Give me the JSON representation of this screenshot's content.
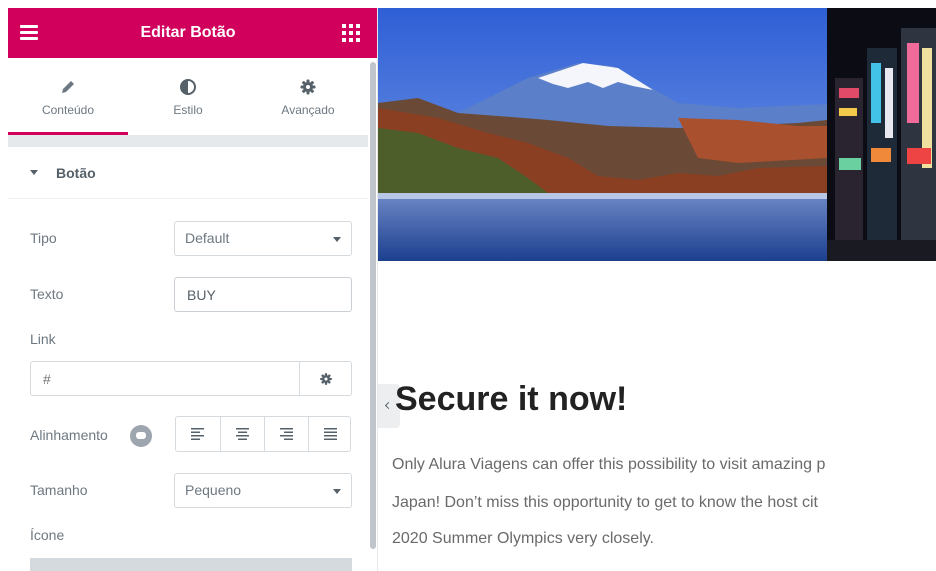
{
  "panel": {
    "title": "Editar Botão",
    "tabs": [
      {
        "label": "Conteúdo",
        "icon": "pencil-icon",
        "active": true
      },
      {
        "label": "Estilo",
        "icon": "contrast-circle-icon",
        "active": false
      },
      {
        "label": "Avançado",
        "icon": "gear-icon",
        "active": false
      }
    ],
    "section_title": "Botão",
    "controls": {
      "tipo": {
        "label": "Tipo",
        "value": "Default"
      },
      "texto": {
        "label": "Texto",
        "value": "BUY"
      },
      "link": {
        "label": "Link",
        "placeholder": "#"
      },
      "alinhamento": {
        "label": "Alinhamento",
        "options": [
          "align-left-icon",
          "align-center-icon",
          "align-right-icon",
          "align-justify-icon"
        ]
      },
      "tamanho": {
        "label": "Tamanho",
        "value": "Pequeno"
      },
      "icone": {
        "label": "Ícone"
      }
    },
    "colors": {
      "accent": "#d1005d",
      "text": "#6d7882"
    }
  },
  "preview": {
    "heading": "Secure it now!",
    "paragraph_lines": [
      "Only Alura Viagens can offer this possibility to visit amazing p",
      "Japan! Don’t miss this opportunity to get to know the host cit",
      "2020 Summer Olympics very closely."
    ]
  }
}
